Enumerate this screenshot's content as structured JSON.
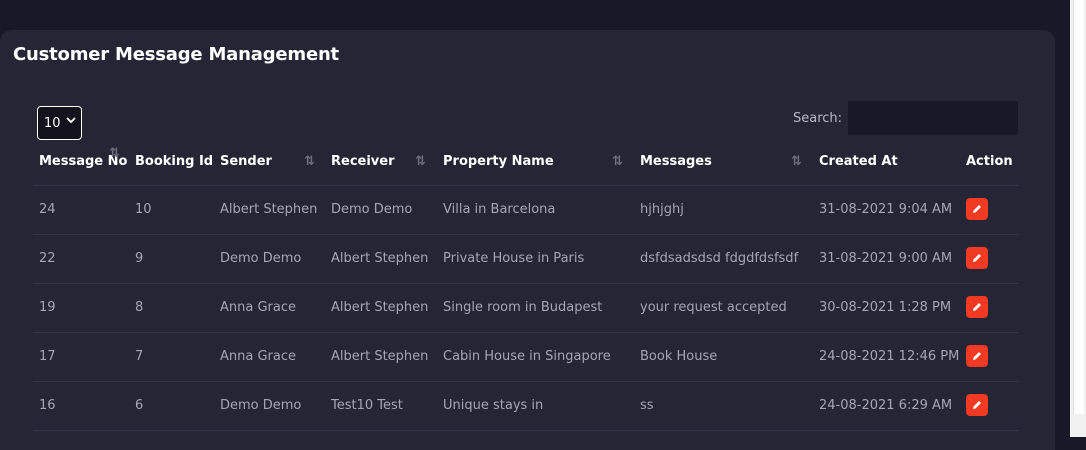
{
  "page": {
    "title": "Customer Message Management"
  },
  "controls": {
    "page_length": "10",
    "search_label": "Search:",
    "search_value": ""
  },
  "table": {
    "columns": [
      "Message No",
      "Booking Id",
      "Sender",
      "Receiver",
      "Property Name",
      "Messages",
      "Created At",
      "Action"
    ],
    "rows": [
      {
        "message_no": "24",
        "booking_id": "10",
        "sender": "Albert Stephen",
        "receiver": "Demo Demo",
        "property": "Villa in Barcelona",
        "message": "hjhjghj",
        "created_at": "31-08-2021 9:04 AM"
      },
      {
        "message_no": "22",
        "booking_id": "9",
        "sender": "Demo Demo",
        "receiver": "Albert Stephen",
        "property": "Private House in Paris",
        "message": "dsfdsadsdsd fdgdfdsfsdf",
        "created_at": "31-08-2021 9:00 AM"
      },
      {
        "message_no": "19",
        "booking_id": "8",
        "sender": "Anna Grace",
        "receiver": "Albert Stephen",
        "property": "Single room in Budapest",
        "message": "your request accepted",
        "created_at": "30-08-2021 1:28 PM"
      },
      {
        "message_no": "17",
        "booking_id": "7",
        "sender": "Anna Grace",
        "receiver": "Albert Stephen",
        "property": "Cabin House in Singapore",
        "message": "Book House",
        "created_at": "24-08-2021 12:46 PM"
      },
      {
        "message_no": "16",
        "booking_id": "6",
        "sender": "Demo Demo",
        "receiver": "Test10 Test",
        "property": "Unique stays in",
        "message": "ss",
        "created_at": "24-08-2021 6:29 AM"
      }
    ]
  },
  "icons": {
    "sort": "sort-arrows-icon",
    "edit": "pencil-icon",
    "dropdown": "chevron-down-icon"
  },
  "colors": {
    "background": "#191826",
    "card": "#252535",
    "action_button": "#f03a23",
    "text_primary": "#ffffff",
    "text_muted": "#a5a5b3"
  }
}
